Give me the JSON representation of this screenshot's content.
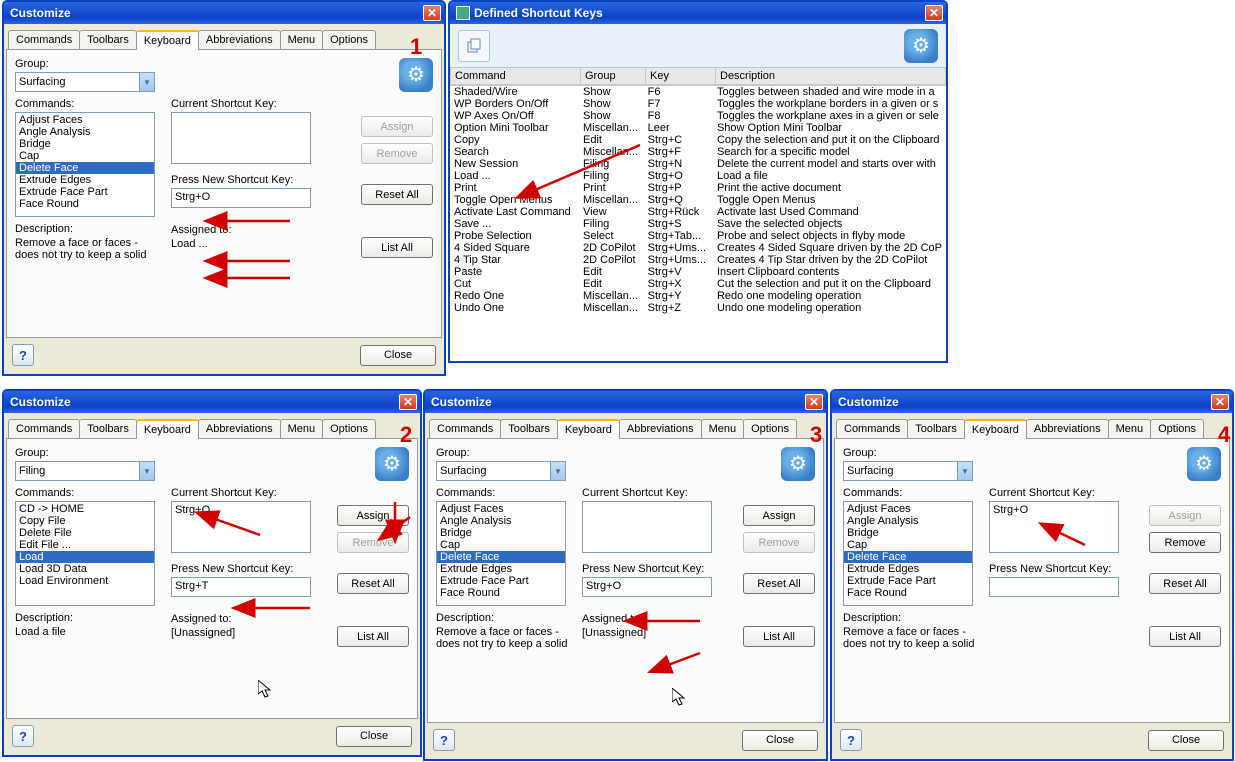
{
  "customize": {
    "title": "Customize",
    "tabs": [
      "Commands",
      "Toolbars",
      "Keyboard",
      "Abbreviations",
      "Menu",
      "Options"
    ],
    "labels": {
      "group": "Group:",
      "commands": "Commands:",
      "current": "Current Shortcut Key:",
      "press": "Press New Shortcut Key:",
      "desc": "Description:",
      "assigned": "Assigned to:"
    },
    "buttons": {
      "assign": "Assign",
      "remove": "Remove",
      "resetall": "Reset All",
      "listall": "List All",
      "close": "Close"
    }
  },
  "surfacing_list": [
    "Adjust Faces",
    "Angle Analysis",
    "Bridge",
    "Cap",
    "Delete Face",
    "Extrude Edges",
    "Extrude Face Part",
    "Face Round"
  ],
  "filing_list": [
    "CD -> HOME",
    "Copy File",
    "Delete File",
    "Edit File ...",
    "Load",
    "Load 3D Data",
    "Load Environment"
  ],
  "dialog1": {
    "group": "Surfacing",
    "selected": "Delete Face",
    "current": "",
    "press": "Strg+O",
    "assigned": "Load ...",
    "desc": "Remove a face or faces - does not try to keep a solid",
    "assign_disabled": true,
    "remove_disabled": true
  },
  "dialog2": {
    "group": "Filing",
    "selected": "Load",
    "current": "Strg+O",
    "press": "Strg+T",
    "assigned": "[Unassigned]",
    "desc": "Load a file",
    "assign_disabled": false,
    "remove_disabled": true
  },
  "dialog3": {
    "group": "Surfacing",
    "selected": "Delete Face",
    "current": "",
    "press": "Strg+O",
    "assigned": "[Unassigned]",
    "desc": "Remove a face or faces - does not try to keep a solid",
    "assign_disabled": false,
    "remove_disabled": true
  },
  "dialog4": {
    "group": "Surfacing",
    "selected": "Delete Face",
    "current": "Strg+O",
    "press": "",
    "assigned": "",
    "desc": "Remove a face or faces - does not try to keep a solid",
    "assign_disabled": true,
    "remove_disabled": false
  },
  "shortcuts": {
    "title": "Defined Shortcut Keys",
    "headers": [
      "Command",
      "Group",
      "Key",
      "Description"
    ],
    "rows": [
      [
        "Shaded/Wire",
        "Show",
        "F6",
        "Toggles between shaded and wire mode in a"
      ],
      [
        "WP Borders On/Off",
        "Show",
        "F7",
        "Toggles the workplane borders in a given or s"
      ],
      [
        "WP Axes On/Off",
        "Show",
        "F8",
        "Toggles the workplane axes in a given or sele"
      ],
      [
        "Option Mini Toolbar",
        "Miscellan...",
        "Leer",
        "Show Option Mini Toolbar"
      ],
      [
        "Copy",
        "Edit",
        "Strg+C",
        "Copy the selection and put it on the Clipboard"
      ],
      [
        "Search",
        "Miscellan...",
        "Strg+F",
        "Search for a specific model"
      ],
      [
        "New Session",
        "Filing",
        "Strg+N",
        "Delete the current model and starts over with"
      ],
      [
        "Load ...",
        "Filing",
        "Strg+O",
        "Load a file"
      ],
      [
        "Print",
        "Print",
        "Strg+P",
        "Print the active document"
      ],
      [
        "Toggle Open Menus",
        "Miscellan...",
        "Strg+Q",
        "Toggle Open Menus"
      ],
      [
        "Activate Last Command",
        "View",
        "Strg+Rück",
        "Activate last Used Command"
      ],
      [
        "Save ...",
        "Filing",
        "Strg+S",
        "Save the selected objects"
      ],
      [
        "Probe Selection",
        "Select",
        "Strg+Tab...",
        "Probe and select objects in flyby mode"
      ],
      [
        "4 Sided Square",
        "2D CoPilot",
        "Strg+Ums...",
        "Creates 4 Sided Square driven by the 2D CoP"
      ],
      [
        "4 Tip Star",
        "2D CoPilot",
        "Strg+Ums...",
        "Creates 4 Tip Star driven by the 2D CoPilot"
      ],
      [
        "Paste",
        "Edit",
        "Strg+V",
        "Insert Clipboard contents"
      ],
      [
        "Cut",
        "Edit",
        "Strg+X",
        "Cut the selection and put it on the Clipboard"
      ],
      [
        "Redo One",
        "Miscellan...",
        "Strg+Y",
        "Redo one modeling operation"
      ],
      [
        "Undo One",
        "Miscellan...",
        "Strg+Z",
        "Undo one modeling operation"
      ]
    ]
  },
  "step_numbers": {
    "1": "1",
    "2": "2",
    "3": "3",
    "4": "4"
  }
}
